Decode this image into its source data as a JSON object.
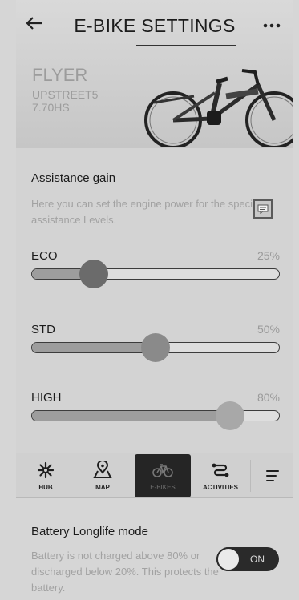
{
  "header": {
    "back_icon": "arrow-left-icon",
    "title": "E-BIKE SETTINGS",
    "more_icon": "more-horizontal-icon",
    "brand": "FLYER",
    "model_line1": "UPSTREET5",
    "model_line2": "7.70HS"
  },
  "assistance": {
    "title": "Assistance gain",
    "description": "Here you can set the engine power for the specific assistance Levels.",
    "levels": [
      {
        "name": "ECO",
        "percent_label": "25%",
        "value": 25,
        "knob_color": "#6b6b6b"
      },
      {
        "name": "STD",
        "percent_label": "50%",
        "value": 50,
        "knob_color": "#8a8a8a"
      },
      {
        "name": "HIGH",
        "percent_label": "80%",
        "value": 80,
        "knob_color": "#a8a8a8"
      }
    ]
  },
  "nav": {
    "items": [
      {
        "label": "HUB",
        "icon": "hub-icon"
      },
      {
        "label": "MAP",
        "icon": "map-pin-icon"
      },
      {
        "label": "E-BIKES",
        "icon": "bike-icon",
        "active": true
      },
      {
        "label": "ACTIVITIES",
        "icon": "route-icon"
      }
    ],
    "menu_icon": "menu-icon"
  },
  "battery": {
    "title": "Battery Longlife mode",
    "description": "Battery is not charged above 80% or discharged below 20%. This protects the battery.",
    "toggle_label": "ON"
  }
}
